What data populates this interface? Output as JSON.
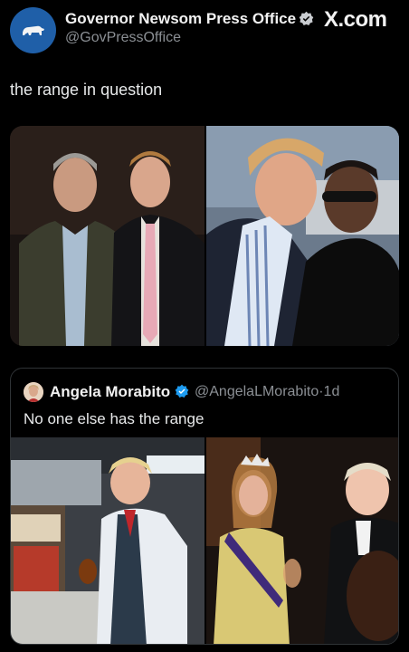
{
  "post": {
    "author_name": "Governor Newsom Press Office",
    "author_handle": "@GovPressOffice",
    "platform": "X.com",
    "text": "the range in question"
  },
  "images": [
    {
      "name": "photo-two-men-suits",
      "description_icon": "photo"
    },
    {
      "name": "photo-two-men-sunglasses",
      "description_icon": "photo"
    }
  ],
  "quoted_post": {
    "author_name": "Angela Morabito",
    "author_handle": "@AngelaLMorabito",
    "separator": "·",
    "time": "1d",
    "text": "No one else has the range"
  },
  "colors": {
    "background": "#000000",
    "verified": "#1d9bf0",
    "avatar": "#1f5fa8",
    "muted_text": "#8b8f94",
    "border": "#2f3336"
  }
}
